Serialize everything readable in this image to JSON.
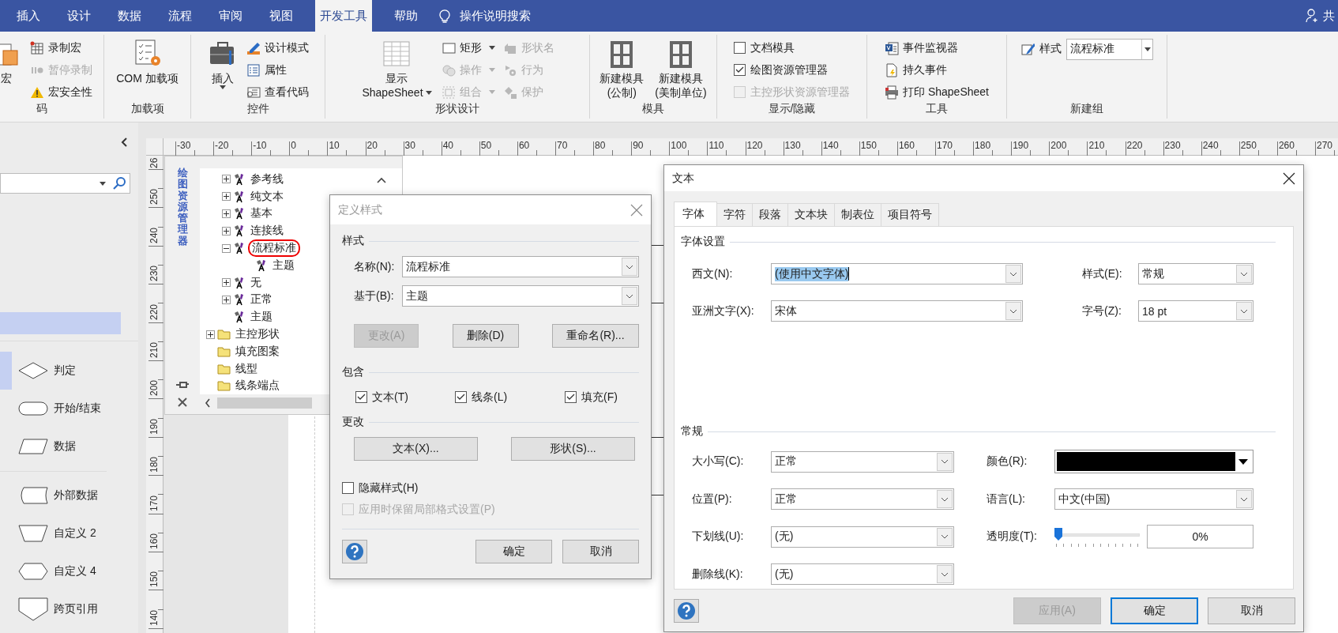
{
  "ribbon_tabs": [
    {
      "label": "插入",
      "selected": false
    },
    {
      "label": "设计",
      "selected": false
    },
    {
      "label": "数据",
      "selected": false
    },
    {
      "label": "流程",
      "selected": false
    },
    {
      "label": "审阅",
      "selected": false
    },
    {
      "label": "视图",
      "selected": false
    },
    {
      "label": "开发工具",
      "selected": true
    },
    {
      "label": "帮助",
      "selected": false
    }
  ],
  "tell_me": "操作说明搜索",
  "share_label": "共",
  "ribbon_groups": [
    {
      "label": "码",
      "items": [
        {
          "kind": "large",
          "lines": [
            "宏"
          ],
          "dropdown": false
        },
        {
          "kind": "small",
          "label": "录制宏",
          "dropdown": false,
          "disabled": false
        },
        {
          "kind": "small",
          "label": "暂停录制",
          "dropdown": false,
          "disabled": true
        },
        {
          "kind": "small",
          "label": "宏安全性",
          "dropdown": false,
          "disabled": false
        }
      ]
    },
    {
      "label": "加载项",
      "items": [
        {
          "kind": "large",
          "lines": [
            "COM 加载项"
          ],
          "dropdown": false
        }
      ]
    },
    {
      "label": "控件",
      "items": [
        {
          "kind": "large",
          "lines": [
            "插入"
          ],
          "dropdown": true
        },
        {
          "kind": "small",
          "label": "设计模式",
          "dropdown": false,
          "disabled": false
        },
        {
          "kind": "small",
          "label": "属性",
          "dropdown": false,
          "disabled": false
        },
        {
          "kind": "small",
          "label": "查看代码",
          "dropdown": false,
          "disabled": false
        }
      ]
    },
    {
      "label": "形状设计",
      "items": [
        {
          "kind": "large",
          "lines": [
            "显示",
            "ShapeSheet"
          ],
          "dropdown": true
        },
        {
          "kind": "small",
          "label": "矩形",
          "dropdown": true,
          "disabled": false
        },
        {
          "kind": "small",
          "label": "操作",
          "dropdown": true,
          "disabled": true
        },
        {
          "kind": "small",
          "label": "组合",
          "dropdown": true,
          "disabled": true
        },
        {
          "kind": "small",
          "label": "形状名",
          "dropdown": false,
          "disabled": true
        },
        {
          "kind": "small",
          "label": "行为",
          "dropdown": false,
          "disabled": true
        },
        {
          "kind": "small",
          "label": "保护",
          "dropdown": false,
          "disabled": true
        }
      ]
    },
    {
      "label": "模具",
      "items": [
        {
          "kind": "large",
          "lines": [
            "新建模具",
            "(公制)"
          ],
          "dropdown": false
        },
        {
          "kind": "large",
          "lines": [
            "新建模具",
            "(美制单位)"
          ],
          "dropdown": false
        }
      ]
    },
    {
      "label": "显示/隐藏",
      "items": [
        {
          "kind": "check",
          "label": "文档模具",
          "checked": false,
          "disabled": false
        },
        {
          "kind": "check",
          "label": "绘图资源管理器",
          "checked": true,
          "disabled": false
        },
        {
          "kind": "check",
          "label": "主控形状资源管理器",
          "checked": false,
          "disabled": true
        }
      ]
    },
    {
      "label": "工具",
      "items": [
        {
          "kind": "small",
          "label": "事件监视器",
          "dropdown": false,
          "disabled": false
        },
        {
          "kind": "small",
          "label": "持久事件",
          "dropdown": false,
          "disabled": false
        },
        {
          "kind": "small",
          "label": "打印 ShapeSheet",
          "dropdown": false,
          "disabled": false
        }
      ]
    },
    {
      "label": "新建组",
      "items": [
        {
          "kind": "combo",
          "label": "样式",
          "value": "流程标准"
        }
      ]
    }
  ],
  "shapes_panel": {
    "shapes": [
      {
        "kind": "diamond",
        "label": "判定",
        "selected": true
      },
      {
        "kind": "terminator",
        "label": "开始/结束",
        "selected": false
      },
      {
        "kind": "parallelogram",
        "label": "数据",
        "selected": false
      },
      {
        "kind": "stored-data",
        "label": "外部数据",
        "selected": false
      },
      {
        "kind": "trapezoid",
        "label": "自定义 2",
        "selected": false
      },
      {
        "kind": "hexagon",
        "label": "自定义 4",
        "selected": false
      },
      {
        "kind": "off-page",
        "label": "跨页引用",
        "selected": false
      }
    ]
  },
  "rulers": {
    "horizontal": [
      "-30",
      "-20",
      "-10",
      "0",
      "10",
      "20",
      "30",
      "40",
      "50",
      "60",
      "70",
      "80",
      "90",
      "100",
      "110",
      "120",
      "130",
      "140",
      "150",
      "160",
      "170",
      "180",
      "190",
      "200",
      "210",
      "220",
      "230",
      "240",
      "250",
      "260",
      "270"
    ],
    "vertical": [
      "26",
      "250",
      "240",
      "230",
      "220",
      "210",
      "200",
      "190",
      "180",
      "170",
      "160",
      "150",
      "140"
    ]
  },
  "drawing_explorer": {
    "title": "绘图资源管理器",
    "styles": [
      {
        "label": "参考线",
        "expanded": false,
        "circled": false
      },
      {
        "label": "纯文本",
        "expanded": false,
        "circled": false
      },
      {
        "label": "基本",
        "expanded": false,
        "circled": false
      },
      {
        "label": "连接线",
        "expanded": false,
        "circled": false
      },
      {
        "label": "流程标准",
        "expanded": true,
        "circled": true,
        "children": [
          {
            "label": "主题",
            "circled": false
          }
        ]
      },
      {
        "label": "无",
        "expanded": false,
        "circled": false
      },
      {
        "label": "正常",
        "expanded": false,
        "circled": false
      },
      {
        "label": "主题",
        "circled": false
      }
    ],
    "folders": [
      {
        "label": "主控形状",
        "expanded": false
      },
      {
        "label": "填充图案"
      },
      {
        "label": "线型"
      },
      {
        "label": "线条端点"
      }
    ]
  },
  "define_style_dialog": {
    "title": "定义样式",
    "style_section": "样式",
    "name_label": "名称(N):",
    "name_value": "流程标准",
    "based_label": "基于(B):",
    "based_value": "主题",
    "style_buttons": [
      {
        "label": "更改(A)",
        "disabled": true
      },
      {
        "label": "删除(D)",
        "disabled": false
      },
      {
        "label": "重命名(R)...",
        "disabled": false
      }
    ],
    "includes_section": "包含",
    "includes": [
      {
        "label": "文本(T)",
        "checked": true
      },
      {
        "label": "线条(L)",
        "checked": true
      },
      {
        "label": "填充(F)",
        "checked": true
      }
    ],
    "change_section": "更改",
    "change_buttons": [
      {
        "label": "文本(X)..."
      },
      {
        "label": "形状(S)..."
      }
    ],
    "options": [
      {
        "label": "隐藏样式(H)",
        "checked": false,
        "disabled": false
      },
      {
        "label": "应用时保留局部格式设置(P)",
        "checked": false,
        "disabled": true
      }
    ],
    "ok": "确定",
    "cancel": "取消"
  },
  "text_dialog": {
    "title": "文本",
    "tabs": [
      {
        "label": "字体",
        "selected": true
      },
      {
        "label": "字符",
        "selected": false
      },
      {
        "label": "段落",
        "selected": false
      },
      {
        "label": "文本块",
        "selected": false
      },
      {
        "label": "制表位",
        "selected": false
      },
      {
        "label": "项目符号",
        "selected": false
      }
    ],
    "font_section": "字体设置",
    "font_fields": [
      {
        "label": "西文(N):",
        "value": "(使用中文字体)",
        "text_selected": true
      },
      {
        "label": "样式(E):",
        "value": "常规",
        "text_selected": false
      },
      {
        "label": "亚洲文字(X):",
        "value": "宋体",
        "text_selected": false
      },
      {
        "label": "字号(Z):",
        "value": "18 pt",
        "text_selected": false
      }
    ],
    "general_section": "常规",
    "general_fields": [
      {
        "kind": "combo",
        "label": "大小写(C):",
        "value": "正常"
      },
      {
        "kind": "color",
        "label": "颜色(R):",
        "color": "#000000"
      },
      {
        "kind": "combo",
        "label": "位置(P):",
        "value": "正常"
      },
      {
        "kind": "combo",
        "label": "语言(L):",
        "value": "中文(中国)"
      },
      {
        "kind": "combo",
        "label": "下划线(U):",
        "value": "(无)"
      },
      {
        "kind": "slider",
        "label": "透明度(T):",
        "level": 0,
        "reading": "0%"
      },
      {
        "kind": "combo",
        "label": "删除线(K):",
        "value": "(无)"
      }
    ],
    "buttons": [
      {
        "label": "应用(A)",
        "disabled": true,
        "default": false
      },
      {
        "label": "确定",
        "disabled": false,
        "default": true
      },
      {
        "label": "取消",
        "disabled": false,
        "default": false
      }
    ]
  }
}
